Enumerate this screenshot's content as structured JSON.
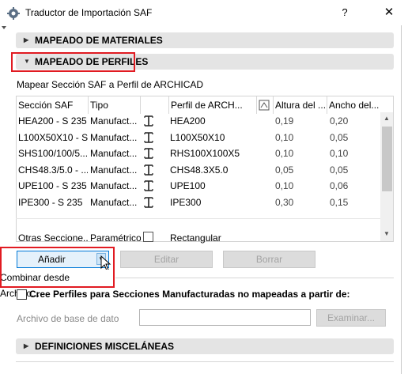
{
  "window": {
    "title": "Traductor de Importación SAF",
    "help_label": "?",
    "close_label": "✕"
  },
  "icons": {
    "app": "gear-app-icon",
    "column": "section-shape-icon",
    "section": "i-beam-icon"
  },
  "sections": {
    "materials": "MAPEADO DE MATERIALES",
    "profiles": "MAPEADO DE PERFILES",
    "misc": "DEFINICIONES MISCELÁNEAS"
  },
  "profiles": {
    "subtitle": "Mapear Sección SAF a Perfil de ARCHICAD",
    "columns": [
      "Sección SAF",
      "Tipo",
      "",
      "Perfil de ARCH...",
      "",
      "Altura del ...",
      "Ancho del..."
    ],
    "rows": [
      {
        "section": "HEA200 - S 235",
        "type": "Manufact...",
        "profile": "HEA200",
        "height": "0,19",
        "width": "0,20"
      },
      {
        "section": "L100X50X10 - S...",
        "type": "Manufact...",
        "profile": "L100X50X10",
        "height": "0,10",
        "width": "0,05"
      },
      {
        "section": "SHS100/100/5....",
        "type": "Manufact...",
        "profile": "RHS100X100X5",
        "height": "0,10",
        "width": "0,10"
      },
      {
        "section": "CHS48.3/5.0 - ...",
        "type": "Manufact...",
        "profile": "CHS48.3X5.0",
        "height": "0,05",
        "width": "0,05"
      },
      {
        "section": "UPE100 - S 235",
        "type": "Manufact...",
        "profile": "UPE100",
        "height": "0,10",
        "width": "0,06"
      },
      {
        "section": "IPE300 - S 235",
        "type": "Manufact...",
        "profile": "IPE300",
        "height": "0,30",
        "width": "0,15"
      }
    ],
    "other_row": {
      "section": "Otras Seccione...",
      "type": "Paramétrico",
      "profile": "Rectangular"
    },
    "buttons": {
      "add": "Añadir",
      "edit": "Editar",
      "delete": "Borrar"
    },
    "dropdown_item": "Combinar desde Archivo..."
  },
  "create_profiles": {
    "checkbox_label": "Cree Perfiles para Secciones Manufacturadas no mapeadas a partir de:",
    "checked": false,
    "db_label": "Archivo de base de dato",
    "db_value": "",
    "browse_label": "Examinar..."
  },
  "colors": {
    "highlight": "#e11b22",
    "section_bg": "#e4e4e4"
  }
}
